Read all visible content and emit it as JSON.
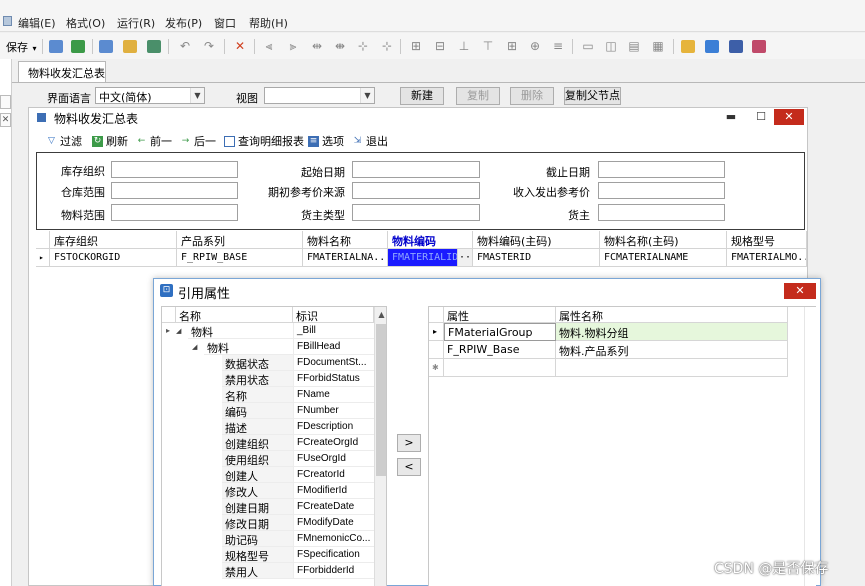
{
  "menubar": {
    "items": [
      "编辑(E)",
      "格式(O)",
      "运行(R)",
      "发布(P)",
      "窗口",
      "帮助(H)"
    ]
  },
  "toolbar": {
    "save_label": "保存",
    "save_arrow": "▾",
    "icons": [
      "form-icon",
      "report-icon",
      "properties-icon",
      "tools-icon",
      "preview-icon",
      "undo-icon",
      "redo-icon",
      "cut-icon",
      "align-left-icon",
      "align-right-icon",
      "align-center-icon",
      "distribute-icon",
      "size-icon",
      "spacing-icon",
      "grid-icon",
      "order-icon",
      "layer-icon",
      "group-icon",
      "ungroup-icon",
      "table-icon",
      "frame-icon",
      "panel-icon",
      "layout-icon",
      "copy-icon",
      "paste-icon",
      "lock-icon",
      "gift-icon"
    ]
  },
  "tabs": [
    {
      "label": "物料收发汇总表"
    }
  ],
  "options_bar": {
    "language_label": "界面语言",
    "language_value": "中文(简体)",
    "view_label": "视图",
    "view_value": "",
    "btn_new": "新建",
    "btn_copy": "复制",
    "btn_delete": "删除",
    "btn_copy_parent": "复制父节点"
  },
  "inner_window": {
    "title": "物料收发汇总表",
    "min_label": "▬",
    "max_label": "☐",
    "close_label": "✕",
    "toolbar": {
      "filter": "过滤",
      "refresh": "刷新",
      "prev": "前一",
      "next": "后一",
      "query_detail": "查询明细报表",
      "options": "选项",
      "exit": "退出"
    },
    "filters": {
      "org": "库存组织",
      "warehouse": "仓库范围",
      "material": "物料范围",
      "start_date": "起始日期",
      "initial_source": "期初参考价来源",
      "owner_type": "货主类型",
      "end_date": "截止日期",
      "inout_source": "收入发出参考价",
      "owner": "货主"
    },
    "grid": {
      "headers": [
        "库存组织",
        "产品系列",
        "物料名称",
        "物料编码",
        "物料编码(主码)",
        "物料名称(主码)",
        "规格型号"
      ],
      "row": [
        "FSTOCKORGID",
        "F_RPIW_BASE",
        "FMATERIALNA...",
        "FMATERIALID",
        "FMASTERID",
        "FCMATERIALNAME",
        "FMATERIALMO..."
      ],
      "ellipsis": "···"
    }
  },
  "dialog": {
    "title": "引用属性",
    "close_label": "✕",
    "tree_headers": [
      "名称",
      "标识"
    ],
    "tree_rows": [
      {
        "name": "物料",
        "id": "_Bill",
        "level": 1,
        "expander": "◢",
        "row_indicator": "▸"
      },
      {
        "name": "物料",
        "id": "FBillHead",
        "level": 2,
        "expander": "◢"
      },
      {
        "name": "数据状态",
        "id": "FDocumentSt...",
        "level": 3
      },
      {
        "name": "禁用状态",
        "id": "FForbidStatus",
        "level": 3
      },
      {
        "name": "名称",
        "id": "FName",
        "level": 3
      },
      {
        "name": "编码",
        "id": "FNumber",
        "level": 3
      },
      {
        "name": "描述",
        "id": "FDescription",
        "level": 3
      },
      {
        "name": "创建组织",
        "id": "FCreateOrgId",
        "level": 3
      },
      {
        "name": "使用组织",
        "id": "FUseOrgId",
        "level": 3
      },
      {
        "name": "创建人",
        "id": "FCreatorId",
        "level": 3
      },
      {
        "name": "修改人",
        "id": "FModifierId",
        "level": 3
      },
      {
        "name": "创建日期",
        "id": "FCreateDate",
        "level": 3
      },
      {
        "name": "修改日期",
        "id": "FModifyDate",
        "level": 3
      },
      {
        "name": "助记码",
        "id": "FMnemonicCo...",
        "level": 3
      },
      {
        "name": "规格型号",
        "id": "FSpecification",
        "level": 3
      },
      {
        "name": "禁用人",
        "id": "FForbidderId",
        "level": 3
      }
    ],
    "move_right": ">",
    "move_left": "<",
    "attr_headers": [
      "属性",
      "属性名称"
    ],
    "attr_rows": [
      {
        "attr": "FMaterialGroup",
        "name": "物料.物料分组",
        "row_indicator": "▸"
      },
      {
        "attr": "F_RPIW_Base",
        "name": "物料.产品系列"
      },
      {
        "attr": "",
        "name": "",
        "row_indicator": "✱"
      }
    ],
    "scroll_up": "▲"
  },
  "watermark": "CSDN @是否保存",
  "colors": {
    "accent": "#2f6fc1",
    "selected_cell": "#1a1aff",
    "highlight_row": "#e6f7dc",
    "close_red": "#c42b1c"
  }
}
